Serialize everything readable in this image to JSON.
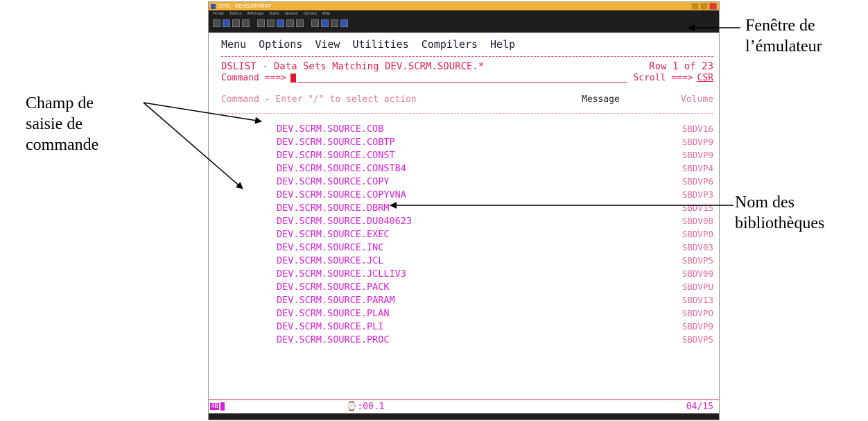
{
  "annotations": {
    "emulator_window": [
      "Fenêtre de",
      "l’émulateur"
    ],
    "command_field": [
      "Champ de",
      "saisie de",
      "commande"
    ],
    "library_names": [
      "Nom des",
      "bibliothèques"
    ]
  },
  "window": {
    "title": "3270 - DEVELOPMENT",
    "menu_items": [
      "Fichier",
      "Edition",
      "Affichage",
      "Outils",
      "Session",
      "Options",
      "Aide"
    ]
  },
  "ispf": {
    "menu": [
      {
        "label": "Menu"
      },
      {
        "label": "Options"
      },
      {
        "label": "View"
      },
      {
        "label": "Utilities"
      },
      {
        "label": "Compilers"
      },
      {
        "label": "Help"
      }
    ],
    "title": "DSLIST - Data Sets Matching DEV.SCRM.SOURCE.*",
    "row_info": "Row 1 of 23",
    "command_label": "Command ===>",
    "scroll_label": "Scroll ===>",
    "scroll_value": "CSR",
    "col_command": "Command - Enter \"/\" to select action",
    "col_message": "Message",
    "col_volume": "Volume",
    "datasets": [
      {
        "name": "DEV.SCRM.SOURCE.COB",
        "volume": "SBDV16"
      },
      {
        "name": "DEV.SCRM.SOURCE.COBTP",
        "volume": "SBDVP9"
      },
      {
        "name": "DEV.SCRM.SOURCE.CONST",
        "volume": "SBDVP9"
      },
      {
        "name": "DEV.SCRM.SOURCE.CONSTB4",
        "volume": "SBDVP4"
      },
      {
        "name": "DEV.SCRM.SOURCE.COPY",
        "volume": "SBDVP6"
      },
      {
        "name": "DEV.SCRM.SOURCE.COPYVNA",
        "volume": "SBDVP3"
      },
      {
        "name": "DEV.SCRM.SOURCE.DBRM",
        "volume": "SBDV15"
      },
      {
        "name": "DEV.SCRM.SOURCE.DU040623",
        "volume": "SBDV08"
      },
      {
        "name": "DEV.SCRM.SOURCE.EXEC",
        "volume": "SBDVP0"
      },
      {
        "name": "DEV.SCRM.SOURCE.INC",
        "volume": "SBDV03"
      },
      {
        "name": "DEV.SCRM.SOURCE.JCL",
        "volume": "SBDVP5"
      },
      {
        "name": "DEV.SCRM.SOURCE.JCLLIV3",
        "volume": "SBDV09"
      },
      {
        "name": "DEV.SCRM.SOURCE.PACK",
        "volume": "SBDVPU"
      },
      {
        "name": "DEV.SCRM.SOURCE.PARAM",
        "volume": "SBDV13"
      },
      {
        "name": "DEV.SCRM.SOURCE.PLAN",
        "volume": "SBDVPO"
      },
      {
        "name": "DEV.SCRM.SOURCE.PLI",
        "volume": "SBDVP9"
      },
      {
        "name": "DEV.SCRM.SOURCE.PROC",
        "volume": "SBDVP5"
      }
    ],
    "status_mark": "4B",
    "timer": "⌚:00.1",
    "cursor_pos": "04/15"
  }
}
